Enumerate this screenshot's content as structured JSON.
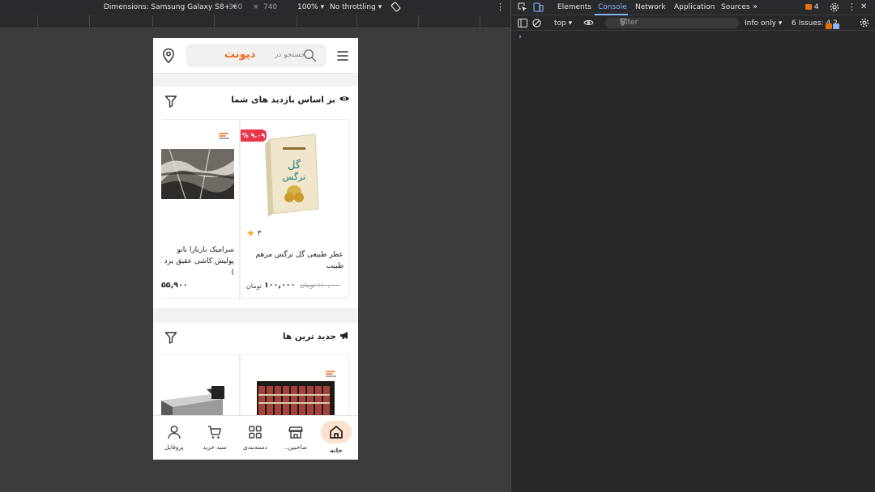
{
  "device_toolbar": {
    "dimensions_label": "Dimensions: Samsung Galaxy S8+",
    "width": "360",
    "times": "×",
    "height": "740",
    "zoom": "100%",
    "throttling": "No throttling"
  },
  "app": {
    "search_prefix": "جستجو در",
    "search_brand": "دپونت",
    "sections": [
      {
        "title": "بر اساس بازدید های شما",
        "products": [
          {
            "title": "عطر طبیعی گل نرگس مرهم طبیب",
            "rating": "۳",
            "discount": "% ۹.۰۹",
            "price": "۱۰۰,۰۰۰",
            "unit": "تومان",
            "old_price": "۱۱۰,۰۰۰ تومان"
          },
          {
            "title": "سرامیک باربارا نانو پولیش کاشی عقیق یزد )",
            "price": "۵۵,۹۰۰"
          }
        ]
      },
      {
        "title": "جدید ترین ها"
      }
    ],
    "bottom_nav": [
      "خانه",
      "صاحبین..",
      "دسته‌بندی",
      "سبد خرید",
      "پروفایل"
    ]
  },
  "devtools": {
    "tabs": [
      "Elements",
      "Console",
      "Network",
      "Application",
      "Sources"
    ],
    "active_tab": "Console",
    "issues_count_top": "4",
    "context": "top",
    "filter_placeholder": "Filter",
    "level": "Info only",
    "issues_label": "6 Issues:",
    "issues_warn": "4",
    "issues_info": "2",
    "prompt": "›"
  },
  "colors": {
    "brand": "#ef6a1c",
    "discount": "#e8364a",
    "star": "#f5a623",
    "devtools_accent": "#8ab4f8",
    "home_pill": "#fde2cf"
  }
}
